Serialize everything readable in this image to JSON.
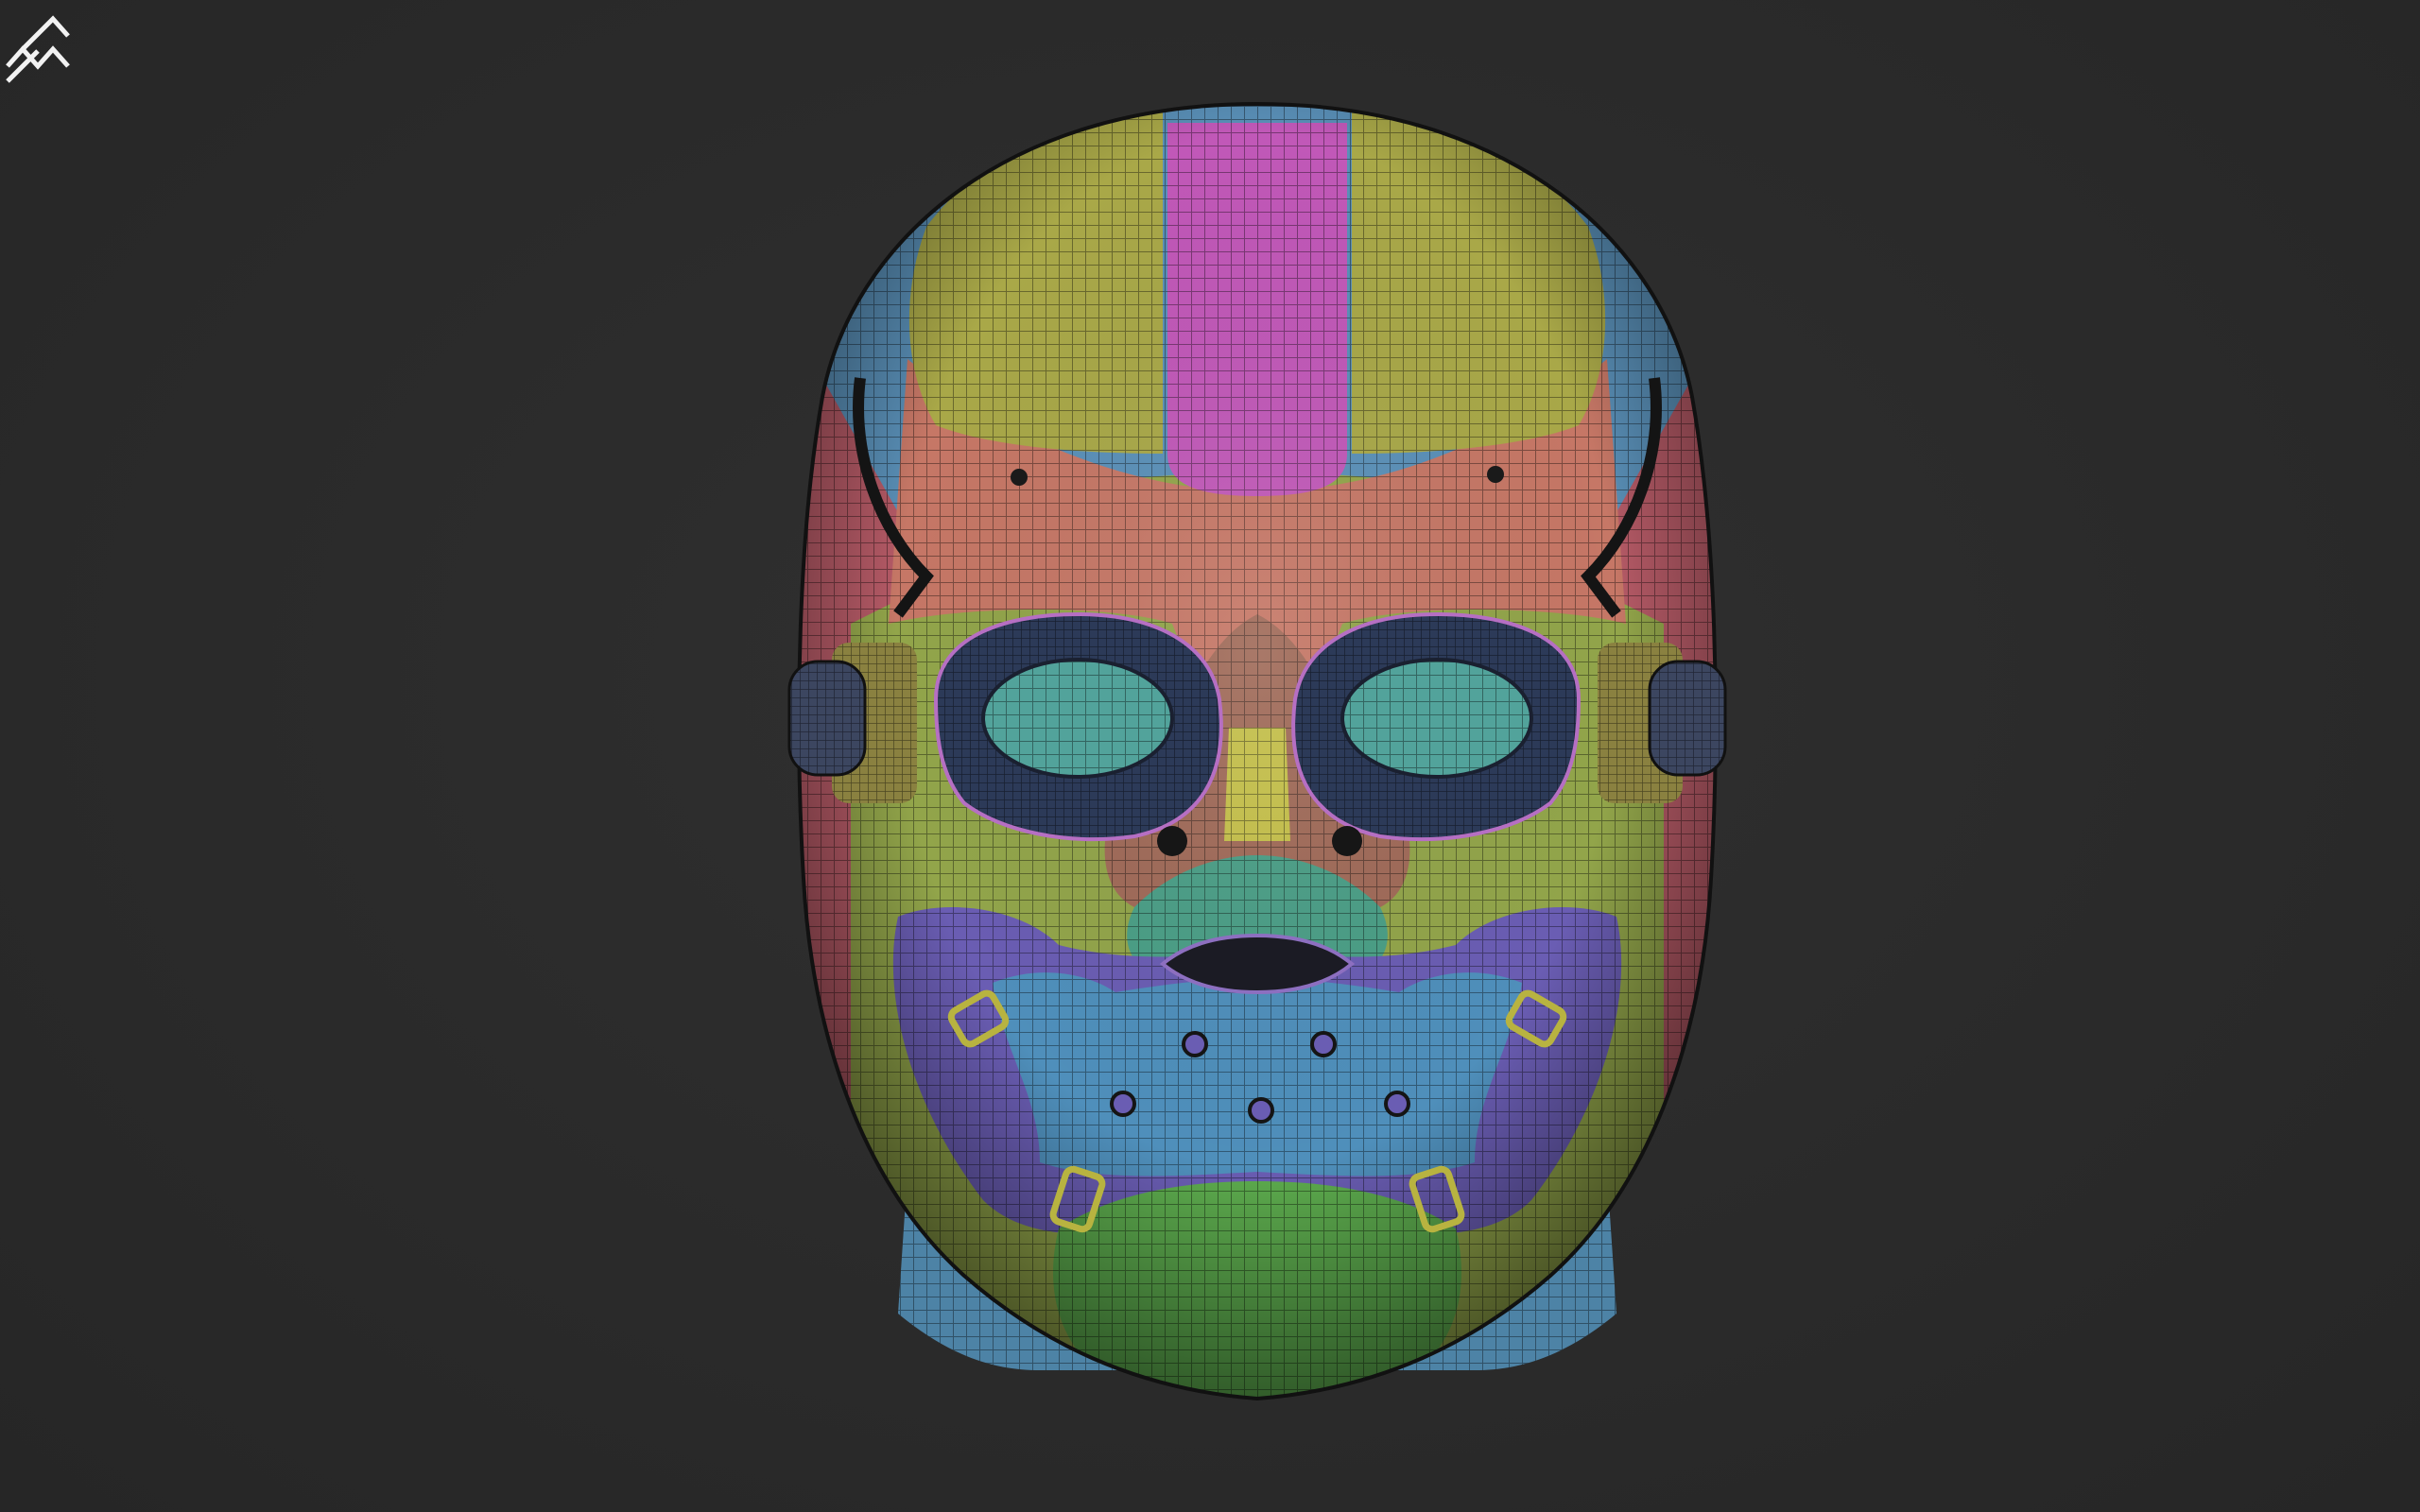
{
  "viewport": {
    "background": "#2b2b2b",
    "model": "polygroup-mask-mesh",
    "display_mode": "polyframe-wireframe"
  },
  "palette": {
    "cranium_yellow": "#a9a848",
    "crest_magenta": "#c158b8",
    "band_blue": "#5a90b8",
    "brow_salmon": "#c67766",
    "temple_red": "#b55a66",
    "face_green": "#92a54a",
    "eye_teal": "#52a39b",
    "goggle_navy": "#2c3a58",
    "goggle_rim_pink": "#b66fc3",
    "nose_yellow": "#c5c04a",
    "nose_brown": "#a06a58",
    "lip_teal": "#4a9e86",
    "mouthplate_blue": "#4f8fbb",
    "mouthplate_purple": "#6a5db3",
    "chin_green": "#5dac4e",
    "clip_yellow": "#b8b340",
    "neck_blue": "#4d83a6",
    "ear_cap_dark": "#3c4660",
    "ear_pad_olive": "#8a8140"
  },
  "icons": {
    "logo": "zbrush-style-logo-icon"
  }
}
